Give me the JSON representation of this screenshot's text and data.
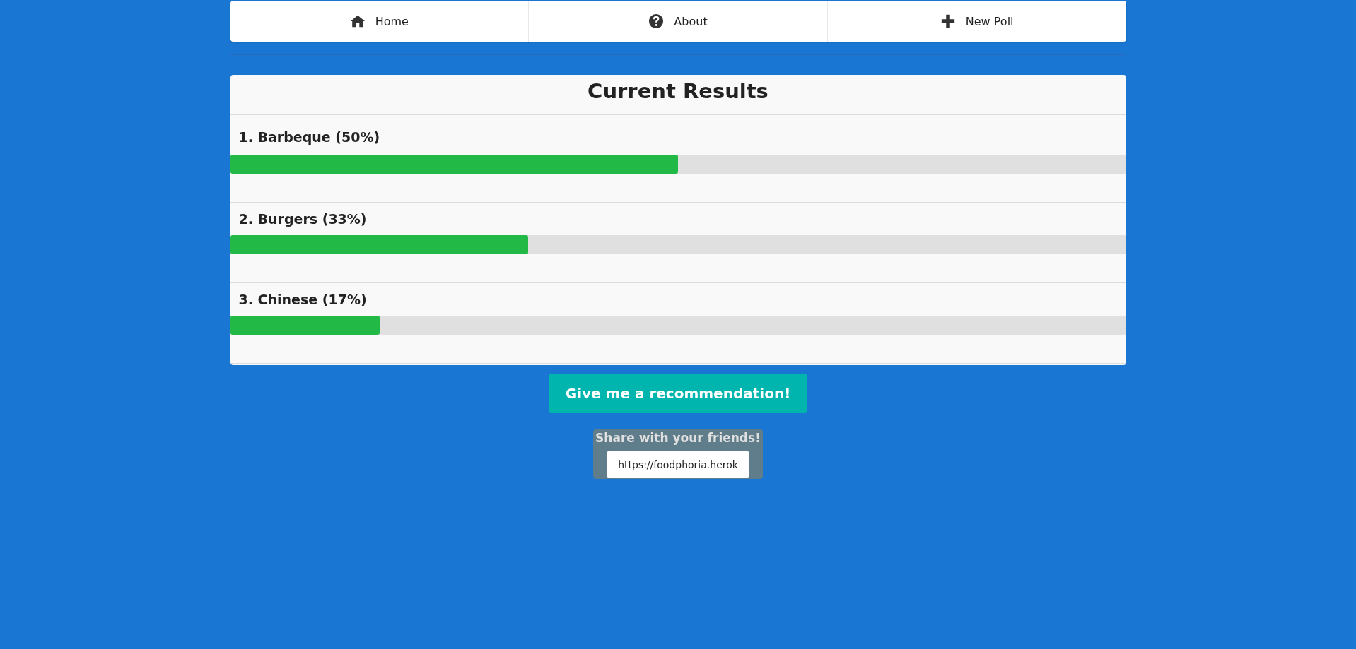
{
  "nav": [
    {
      "label": "Home",
      "kind": "home"
    },
    {
      "label": "About",
      "kind": "question"
    },
    {
      "label": "New Poll",
      "kind": "plus"
    }
  ],
  "results": {
    "title": "Current Results",
    "options": [
      {
        "label": "1. Barbeque (50%)",
        "level": 0.5
      },
      {
        "label": "2. Burgers (33%)",
        "level": 0.333
      },
      {
        "label": "3. Chinese (17%)",
        "level": 0.167
      }
    ]
  },
  "recommend_button": "Give me a recommendation!",
  "share": {
    "title": "Share with your friends!",
    "link": "https://foodphoria.herok"
  }
}
